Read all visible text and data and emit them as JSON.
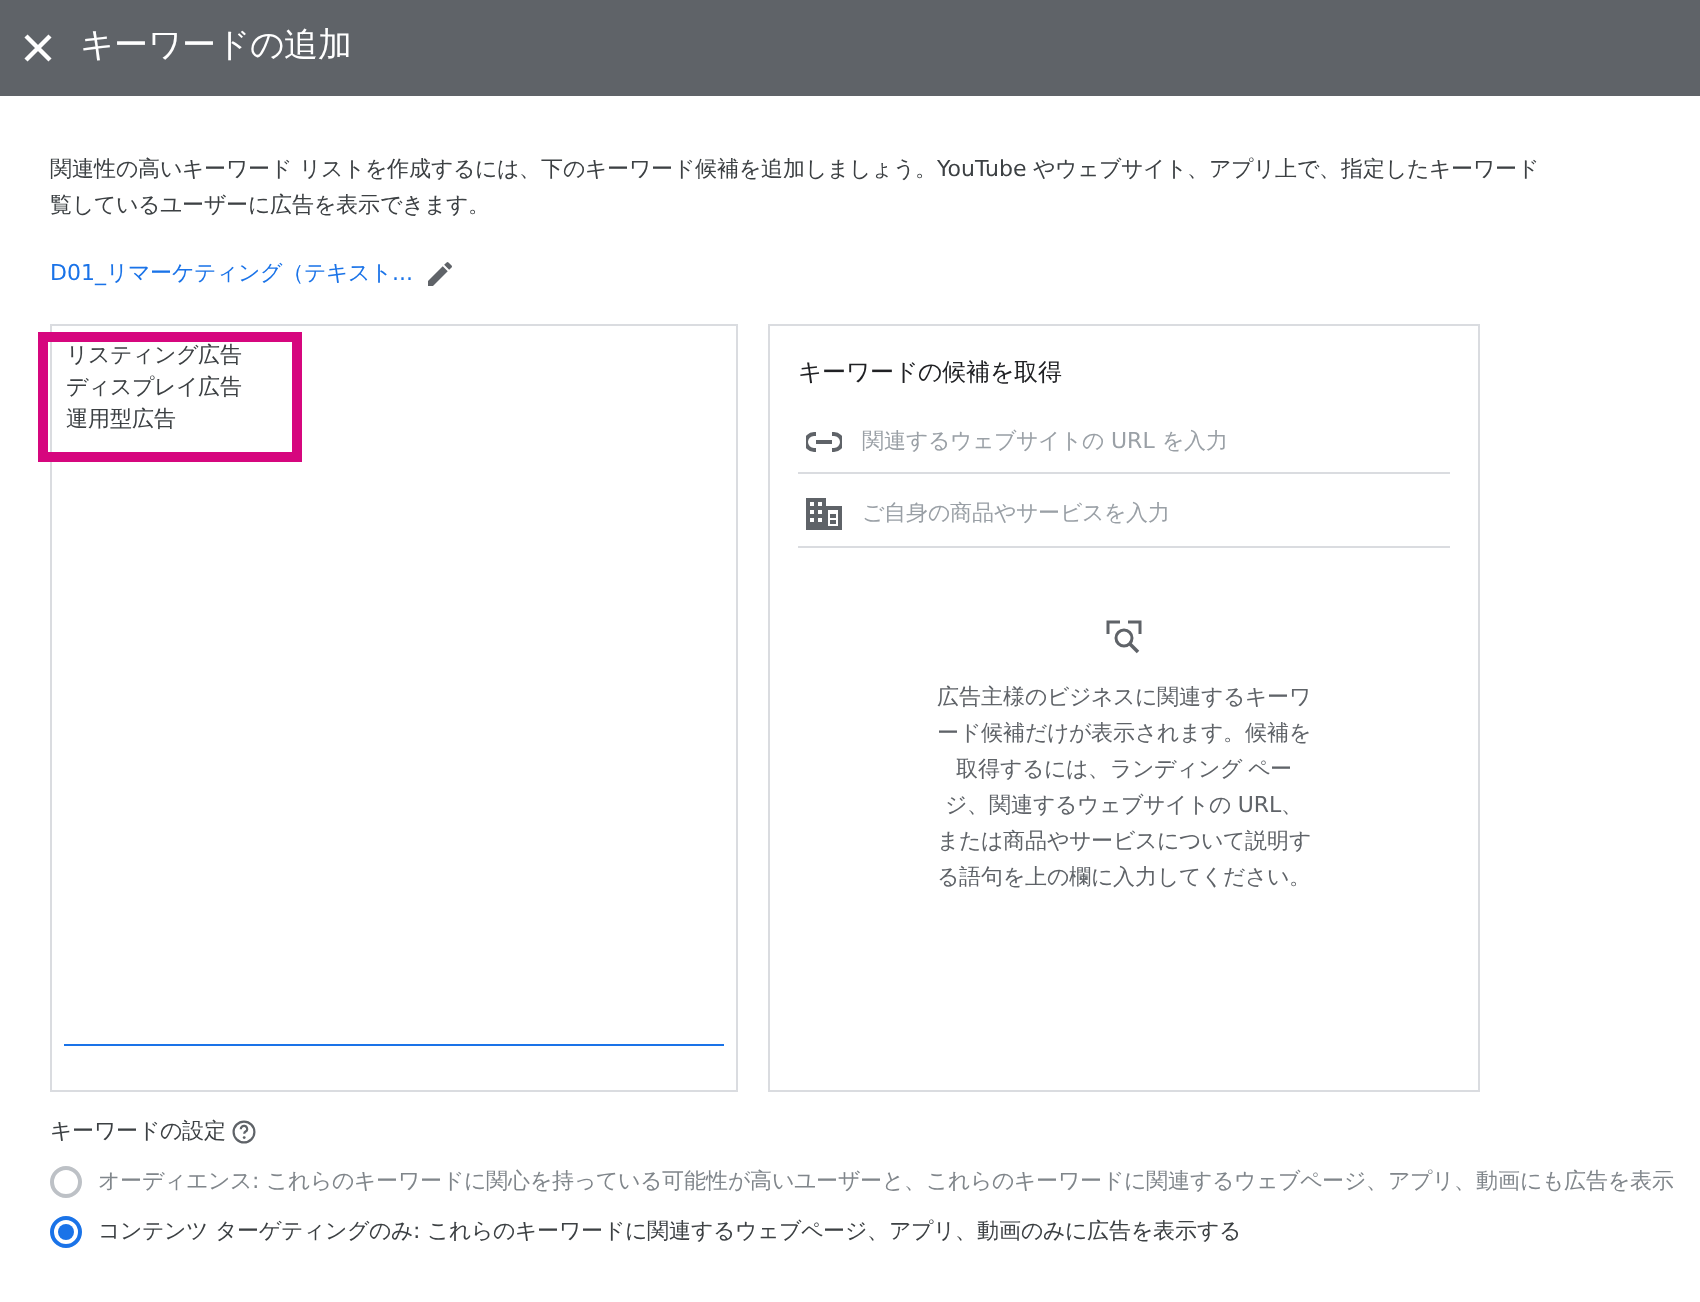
{
  "window": {
    "title": "キーワードの追加"
  },
  "description_lines": [
    "関連性の高いキーワード リストを作成するには、下のキーワード候補を追加しましょう。YouTube やウェブサイト、アプリ上で、指定したキーワード",
    "覧しているユーザーに広告を表示できます。"
  ],
  "ad_group_link": "D01_リマーケティング（テキスト...",
  "keywords_input": {
    "lines": [
      "リスティング広告",
      "ディスプレイ広告",
      "運用型広告"
    ],
    "highlighted": true,
    "focused": true
  },
  "suggestions": {
    "title": "キーワードの候補を取得",
    "fields": [
      {
        "kind": "link",
        "placeholder": "関連するウェブサイトの URL を入力"
      },
      {
        "kind": "building",
        "placeholder": "ご自身の商品やサービスを入力"
      }
    ],
    "empty_message": "広告主様のビジネスに関連するキーワード候補だけが表示されます。候補を取得するには、ランディング ページ、関連するウェブサイトの URL、または商品やサービスについて説明する語句を上の欄に入力してください。"
  },
  "keyword_settings": {
    "label": "キーワードの設定",
    "options": [
      {
        "label": "オーディエンス: これらのキーワードに関心を持っている可能性が高いユーザーと、これらのキーワードに関連するウェブページ、アプリ、動画にも広告を表示",
        "selected": false,
        "disabled": true
      },
      {
        "label": "コンテンツ ターゲティングのみ: これらのキーワードに関連するウェブページ、アプリ、動画のみに広告を表示する",
        "selected": true,
        "disabled": false
      }
    ]
  }
}
